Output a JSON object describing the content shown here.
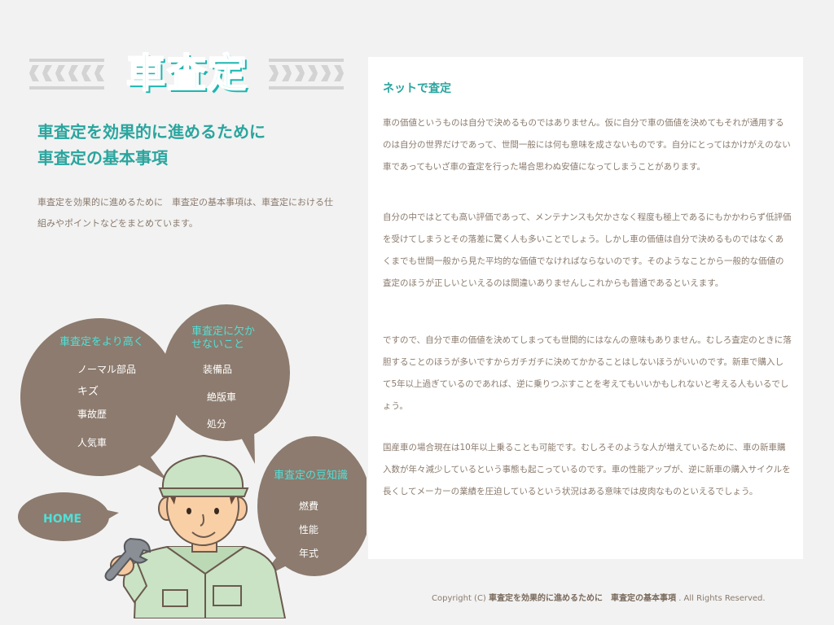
{
  "logo": {
    "text": "車査定"
  },
  "header": {
    "title_line1": "車査定を効果的に進めるために",
    "title_line2": "車査定の基本事項",
    "description": "車査定を効果的に進めるために　車査定の基本事項は、車査定における仕組みやポイントなどをまとめています。"
  },
  "nav": {
    "bubble1": {
      "title": "車査定をより高く",
      "items": [
        "ノーマル部品",
        "キズ",
        "事故歴",
        "人気車"
      ]
    },
    "bubble2": {
      "title_line1": "車査定に欠か",
      "title_line2": "せないこと",
      "items": [
        "装備品",
        "絶版車",
        "処分"
      ]
    },
    "bubble3": {
      "title": "車査定の豆知識",
      "items": [
        "燃費",
        "性能",
        "年式"
      ]
    },
    "home": "HOME"
  },
  "main": {
    "title": "ネットで査定",
    "paragraphs": [
      "車の価値というものは自分で決めるものではありません。仮に自分で車の価値を決めてもそれが通用するのは自分の世界だけであって、世間一般には何も意味を成さないものです。自分にとってはかけがえのない車であってもいざ車の査定を行った場合思わぬ安値になってしまうことがあります。",
      "自分の中ではとても高い評価であって、メンテナンスも欠かさなく程度も極上であるにもかかわらず低評価を受けてしまうとその落差に驚く人も多いことでしょう。しかし車の価値は自分で決めるものではなくあくまでも世間一般から見た平均的な価値でなければならないのです。そのようなことから一般的な価値の査定のほうが正しいといえるのは間違いありませんしこれからも普通であるといえます。",
      "ですので、自分で車の価値を決めてしまっても世間的にはなんの意味もありません。むしろ査定のときに落胆することのほうが多いですからガチガチに決めてかかることはしないほうがいいのです。新車で購入して5年以上過ぎているのであれば、逆に乗りつぶすことを考えてもいいかもしれないと考える人もいるでしょう。",
      "国産車の場合現在は10年以上乗ることも可能です。むしろそのような人が増えているために、車の新車購入数が年々減少しているという事態も起こっているのです。車の性能アップが、逆に新車の購入サイクルを長くしてメーカーの業績を圧迫しているという状況はある意味では皮肉なものといえるでしょう。"
    ]
  },
  "footer": {
    "prefix": "Copyright (C) ",
    "site_name": "車査定を効果的に進めるために　車査定の基本事項",
    "suffix": ". All Rights Reserved."
  },
  "colors": {
    "background": "#f2f2f2",
    "accent": "#2aa59e",
    "logo": "#3ee8e0",
    "bubble": "#8c7b6e",
    "bubble_title": "#4fe0d8",
    "text": "#8a7a6c"
  }
}
